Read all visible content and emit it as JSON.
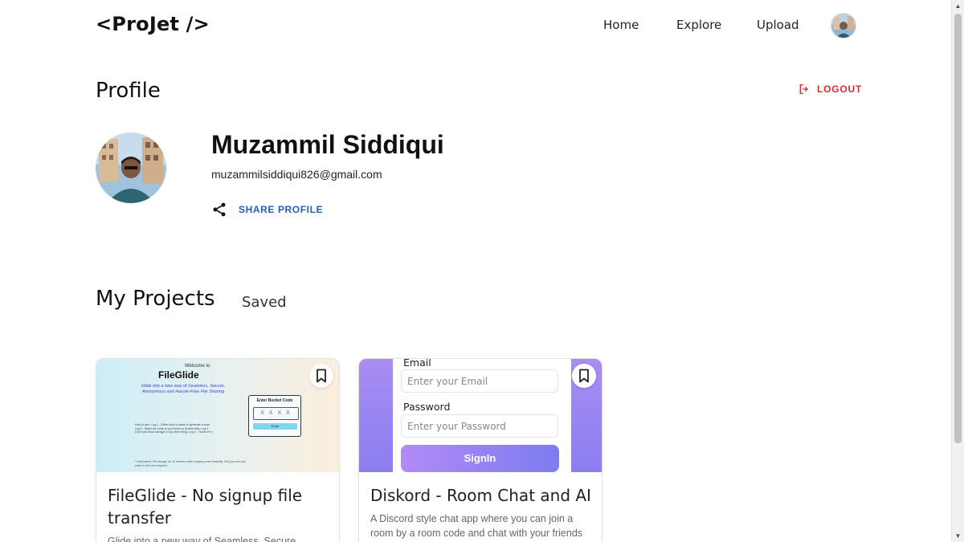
{
  "nav": {
    "logo": "<ProJet />",
    "links": [
      "Home",
      "Explore",
      "Upload"
    ]
  },
  "profile": {
    "title": "Profile",
    "logout_label": "LOGOUT",
    "name": "Muzammil Siddiqui",
    "email": "muzammilsiddiqui826@gmail.com",
    "share_label": "SHARE PROFILE"
  },
  "tabs": {
    "active": "My Projects",
    "other": "Saved"
  },
  "projects": [
    {
      "title": "FileGlide - No signup file transfer",
      "description": "Glide into a new way of Seamless, Secure",
      "thumbnail": {
        "welcome": "Welcome to",
        "brand": "FileGlide",
        "tagline": "Glide into a new way of Seamless, Secure, Anonymous and Hassle-Free File Sharing",
        "steps": "How to use : Log 1 - Either drop or paste to generate a code. Log 2 - Share the code to your friend to receive files. Log 3 - Don't use cloud storage or any other thing. Log 4 - Thank me :)",
        "note": "* Information: File storage for 10 minutes while enjoying more flexibility. Get your link and share it with one recipient.",
        "box_title": "Enter Bucket Code",
        "code_placeholder": "X X X X",
        "enter_label": "Enter"
      }
    },
    {
      "title": "Diskord - Room Chat and AI",
      "description": "A Discord style chat app where you can join a room by a room code and chat with your friends",
      "thumbnail": {
        "email_label": "Email",
        "email_placeholder": "Enter your Email",
        "password_label": "Password",
        "password_placeholder": "Enter your Password",
        "signin_label": "SignIn"
      }
    }
  ],
  "colors": {
    "logout": "#d32f2f",
    "share": "#1f5fb8",
    "signin_gradient_start": "#b18af6",
    "signin_gradient_end": "#7d7cf0"
  }
}
